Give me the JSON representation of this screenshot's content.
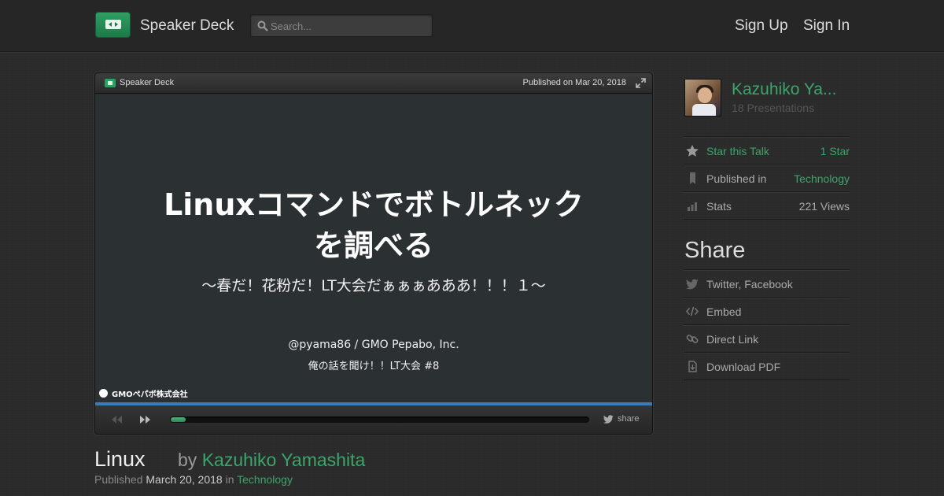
{
  "header": {
    "brand": "Speaker Deck",
    "search_placeholder": "Search...",
    "sign_up": "Sign Up",
    "sign_in": "Sign In"
  },
  "player": {
    "brand": "Speaker Deck",
    "published": "Published on Mar 20, 2018",
    "share_label": "share",
    "progress_fraction": 0.035,
    "slide": {
      "title_line1": "Linuxコマンドでボトルネック",
      "title_line2": "を調べる",
      "subtitle": "〜春だ！花粉だ！LT大会だぁぁぁあああ！！！１〜",
      "author": "@pyama86 / GMO Pepabo, Inc.",
      "event": "俺の話を聞け！！LT大会 #8",
      "logo_text": "GMOペパボ株式会社"
    }
  },
  "talk": {
    "title": "Linux",
    "by": "by",
    "author": "Kazuhiko Yamashita",
    "published_label": "Published",
    "published_date": "March 20, 2018",
    "in_label": "in",
    "category": "Technology"
  },
  "sidebar": {
    "user_name": "Kazuhiko Ya...",
    "presentations": "18 Presentations",
    "rows": [
      {
        "icon": "star-icon",
        "label": "Star this Talk",
        "value": "1 Star"
      },
      {
        "icon": "bookmark-icon",
        "label": "Published in",
        "value": "Technology"
      },
      {
        "icon": "bar-chart-icon",
        "label": "Stats",
        "value": "221 Views"
      }
    ],
    "share_heading": "Share",
    "share_items": [
      {
        "icon": "twitter-icon",
        "label": "Twitter, Facebook"
      },
      {
        "icon": "code-icon",
        "label": "Embed"
      },
      {
        "icon": "link-icon",
        "label": "Direct Link"
      },
      {
        "icon": "download-icon",
        "label": "Download PDF"
      }
    ]
  },
  "colors": {
    "accent_green": "#3ba56a",
    "background": "#2a2a2a",
    "slide_background": "#2b3033",
    "progress_blue": "#3d7ab3"
  }
}
